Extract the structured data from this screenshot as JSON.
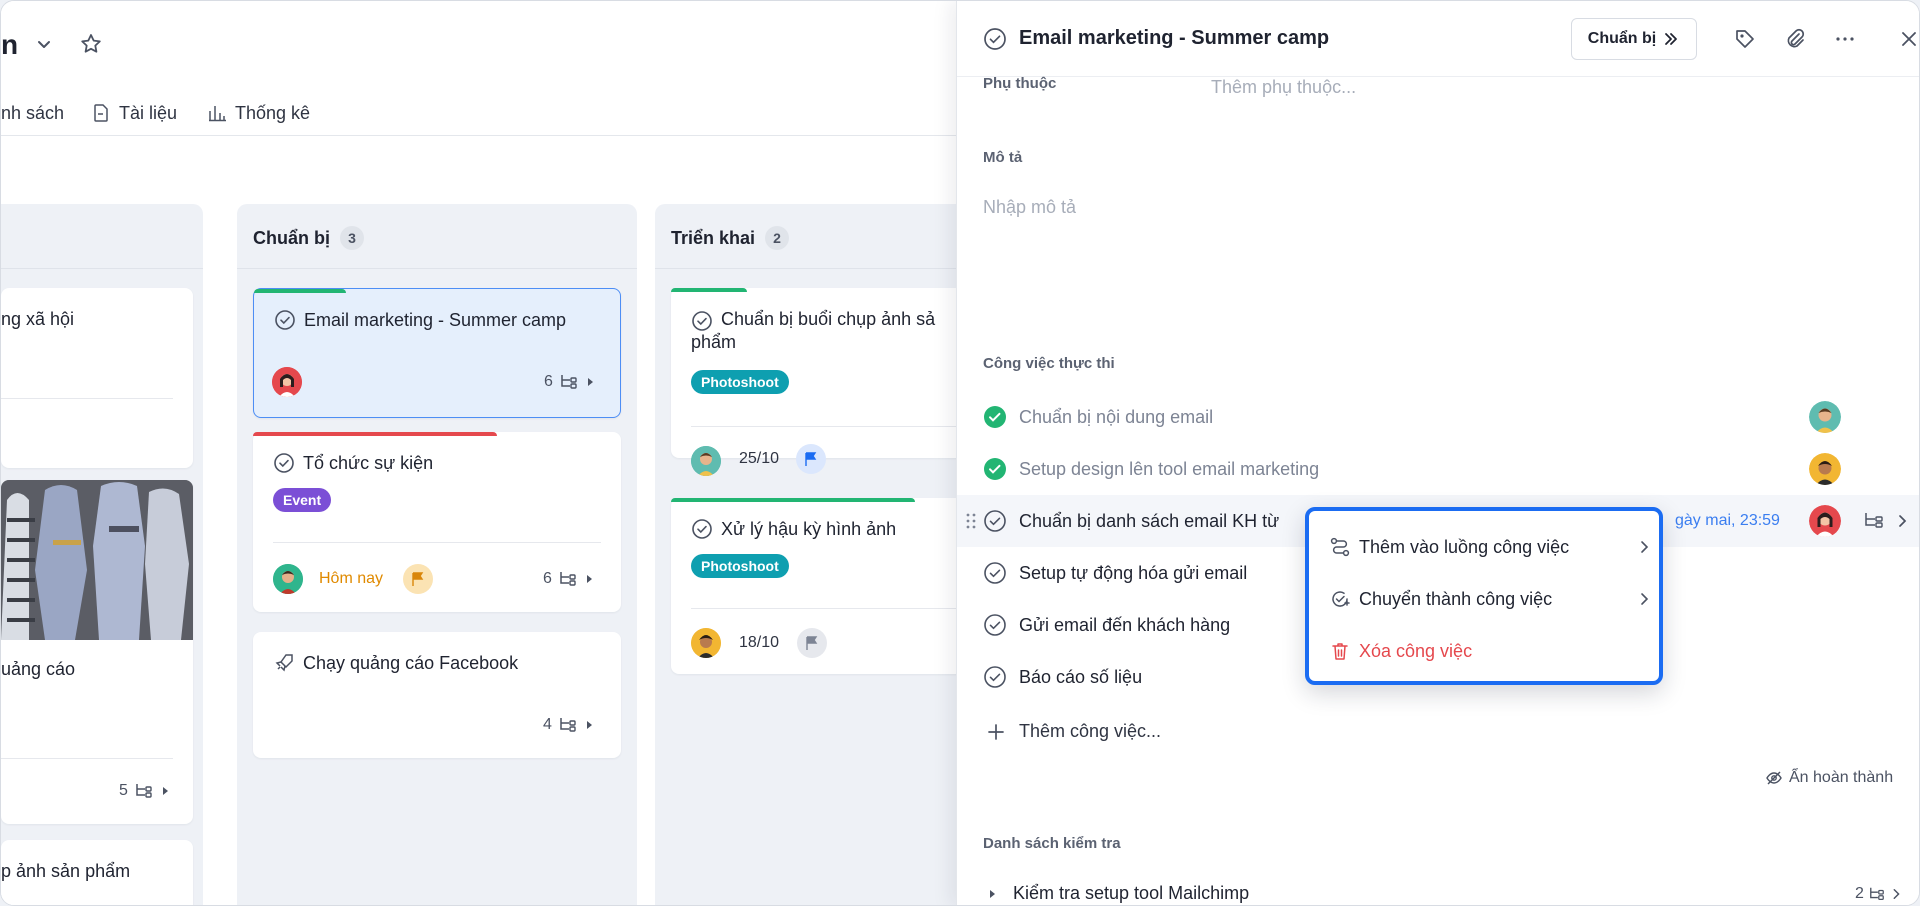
{
  "project": {
    "title_tail": "n"
  },
  "tabs": [
    {
      "label": "nh sách"
    },
    {
      "label": "Tài liệu"
    },
    {
      "label": "Thống kê"
    }
  ],
  "columns": [
    {
      "cards": [
        {
          "title": "ng xã hội"
        },
        {
          "title": "uảng cáo",
          "subtasks": "5"
        },
        {
          "title": "p ảnh sản phẩm"
        }
      ]
    },
    {
      "name": "Chuẩn bị",
      "count": "3",
      "cards": [
        {
          "title": "Email marketing - Summer camp",
          "subtasks": "6"
        },
        {
          "title": "Tổ chức sự kiện",
          "tag": "Event",
          "due": "Hôm nay",
          "subtasks": "6"
        },
        {
          "title": "Chạy quảng cáo Facebook",
          "subtasks": "4"
        }
      ]
    },
    {
      "name": "Triển khai",
      "count": "2",
      "cards": [
        {
          "title_line1": "Chuẩn bị buổi chụp ảnh sả",
          "title_line2": "phẩm",
          "tag": "Photoshoot",
          "due": "25/10"
        },
        {
          "title": "Xử lý hậu kỳ hình ảnh",
          "tag": "Photoshoot",
          "due": "18/10"
        }
      ]
    }
  ],
  "panel": {
    "title": "Email marketing - Summer camp",
    "status_label": "Chuẩn bị",
    "dependency_label": "Phụ thuộc",
    "dependency_placeholder": "Thêm phụ thuộc...",
    "description_label": "Mô tả",
    "description_placeholder": "Nhập mô tả",
    "subtasks_label": "Công việc thực thi",
    "subtasks": [
      {
        "name": "Chuẩn bị nội dung email",
        "done": true
      },
      {
        "name": "Setup design lên tool email marketing",
        "done": true
      },
      {
        "name": "Chuẩn bị danh sách email KH từ",
        "done": false,
        "due": "gày mai, 23:59"
      },
      {
        "name": "Setup tự động hóa gửi email",
        "done": false
      },
      {
        "name": "Gửi email đến khách hàng",
        "done": false
      },
      {
        "name": "Báo cáo số liệu",
        "done": false
      }
    ],
    "add_task_label": "Thêm công việc...",
    "hide_done_label": "Ẩn hoàn thành",
    "checklist_label": "Danh sách kiểm tra",
    "checklist_item": "Kiểm tra setup tool Mailchimp",
    "checklist_count": "2"
  },
  "context_menu": {
    "items": [
      {
        "label": "Thêm vào luồng công việc"
      },
      {
        "label": "Chuyển thành công việc"
      },
      {
        "label": "Xóa công việc"
      }
    ]
  },
  "colors": {
    "accent": "#1b6cf2",
    "green": "#22b573",
    "red": "#e5484d",
    "event_tag": "#7b4fd6",
    "photoshoot_tag": "#0e9fb0"
  }
}
